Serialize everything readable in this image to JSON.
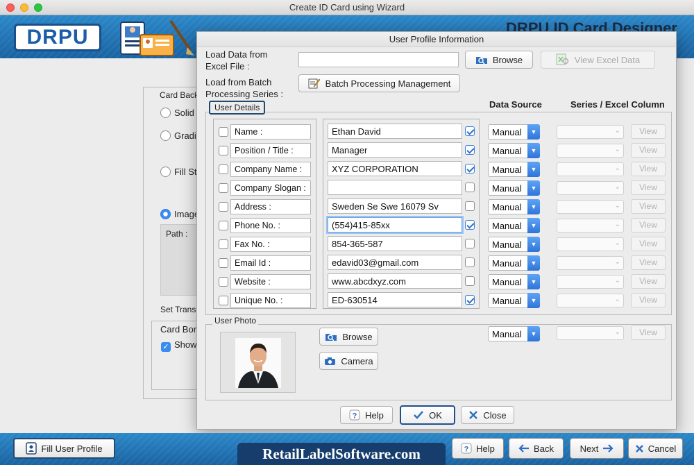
{
  "window": {
    "title": "Create ID Card using Wizard"
  },
  "header": {
    "logo": "DRPU",
    "app_title": "DRPU ID Card Designer"
  },
  "background": {
    "card_background_label": "Card Back",
    "radio_solid": "Solid",
    "radio_gradient": "Gradi",
    "radio_fill": "Fill St",
    "radio_image": "Image",
    "path_label": "Path :",
    "set_transparency": "Set Transp",
    "card_border": "Card Bor",
    "show_label": "Show"
  },
  "dialog": {
    "title": "User Profile Information",
    "load_excel_label": "Load Data from\nExcel File :",
    "load_excel_value": "",
    "browse_label": "Browse",
    "view_excel_label": "View Excel Data",
    "load_batch_label": "Load from Batch\nProcessing Series :",
    "batch_button_label": "Batch Processing Management",
    "user_details_legend": "User Details",
    "data_source_header": "Data Source",
    "series_header": "Series / Excel Column",
    "fields": [
      {
        "label": "Name :",
        "value": "Ethan David",
        "show": true,
        "source": "Manual",
        "view": "View"
      },
      {
        "label": "Position / Title :",
        "value": "Manager",
        "show": true,
        "source": "Manual",
        "view": "View"
      },
      {
        "label": "Company Name :",
        "value": "XYZ CORPORATION",
        "show": true,
        "source": "Manual",
        "view": "View"
      },
      {
        "label": "Company Slogan :",
        "value": "",
        "show": false,
        "source": "Manual",
        "view": "View"
      },
      {
        "label": "Address :",
        "value": "Sweden Se Swe 16079 Sv",
        "show": false,
        "source": "Manual",
        "view": "View"
      },
      {
        "label": "Phone No. :",
        "value": "(554)415-85xx",
        "show": true,
        "source": "Manual",
        "view": "View"
      },
      {
        "label": "Fax No. :",
        "value": "854-365-587",
        "show": false,
        "source": "Manual",
        "view": "View"
      },
      {
        "label": "Email Id :",
        "value": "edavid03@gmail.com",
        "show": false,
        "source": "Manual",
        "view": "View"
      },
      {
        "label": "Website :",
        "value": "www.abcdxyz.com",
        "show": false,
        "source": "Manual",
        "view": "View"
      },
      {
        "label": "Unique No. :",
        "value": "ED-630514",
        "show": true,
        "source": "Manual",
        "view": "View"
      }
    ],
    "user_photo_legend": "User Photo",
    "photo_browse_label": "Browse",
    "camera_label": "Camera",
    "photo_source": "Manual",
    "photo_view": "View",
    "help_label": "Help",
    "ok_label": "OK",
    "close_label": "Close"
  },
  "bottom": {
    "fill_profile_label": "Fill User Profile",
    "brand": "RetailLabelSoftware.com",
    "help_label": "Help",
    "back_label": "Back",
    "next_label": "Next",
    "cancel_label": "Cancel"
  },
  "colors": {
    "header_blue": "#1f6fb2",
    "accent": "#2f75d9",
    "dark_navy": "#163d6b"
  }
}
